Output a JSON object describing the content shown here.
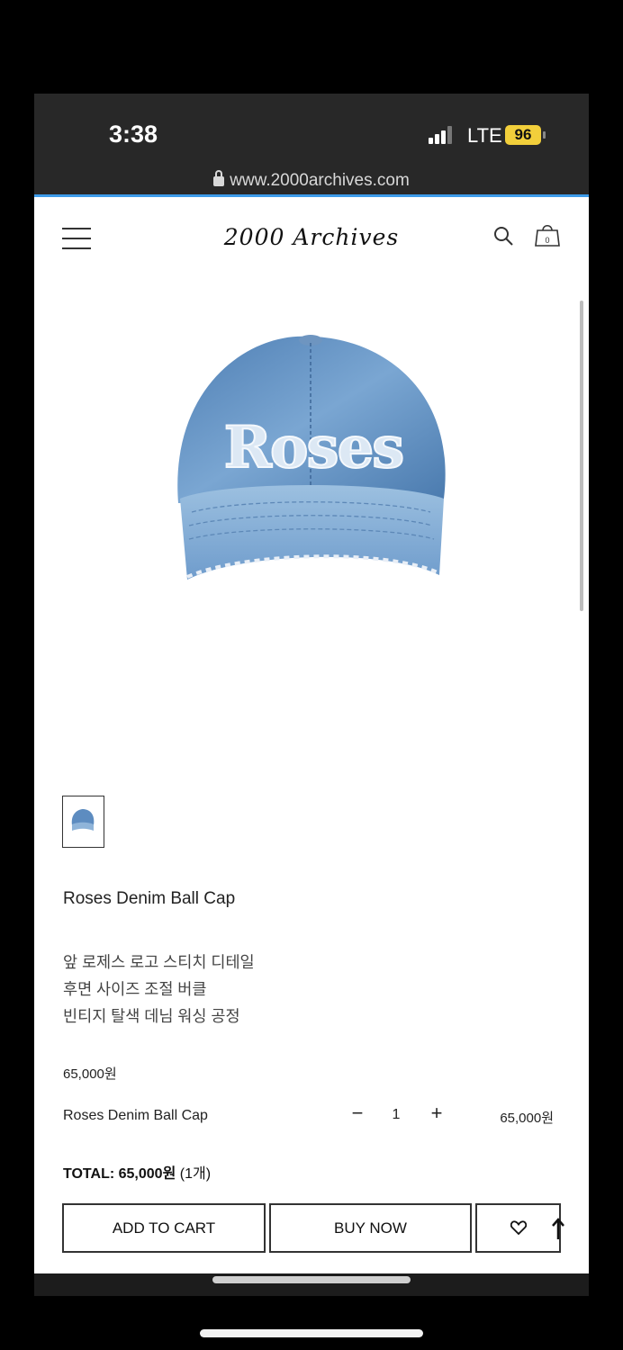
{
  "status_bar": {
    "time": "3:38",
    "network": "LTE",
    "battery": "96",
    "url": "www.2000archives.com"
  },
  "header": {
    "logo": "2000 Archives",
    "cart_count": "0",
    "menu_icon": "hamburger-menu-icon",
    "search_icon": "search-icon",
    "cart_icon": "shopping-bag-icon"
  },
  "product": {
    "image": "denim-cap-image",
    "name": "Roses Denim Ball Cap",
    "description": [
      "앞 로제스 로고 스티치 디테일",
      "후면 사이즈 조절 버클",
      "빈티지 탈색 데님 워싱 공정"
    ],
    "price": "65,000원"
  },
  "option": {
    "name": "Roses Denim Ball Cap",
    "minus": "−",
    "quantity": "1",
    "plus": "+",
    "price": "65,000원"
  },
  "total": {
    "label": "TOTAL:",
    "amount": "65,000원",
    "count": "(1개)"
  },
  "actions": {
    "add_to_cart": "ADD TO CART",
    "buy_now": "BUY NOW",
    "wishlist_icon": "heart-icon",
    "scroll_top_icon": "up-arrow-icon"
  },
  "colors": {
    "status_bar": "#282828",
    "battery": "#f2cf3b",
    "progress": "#3d9be9",
    "denim": "#6f9ccc"
  }
}
